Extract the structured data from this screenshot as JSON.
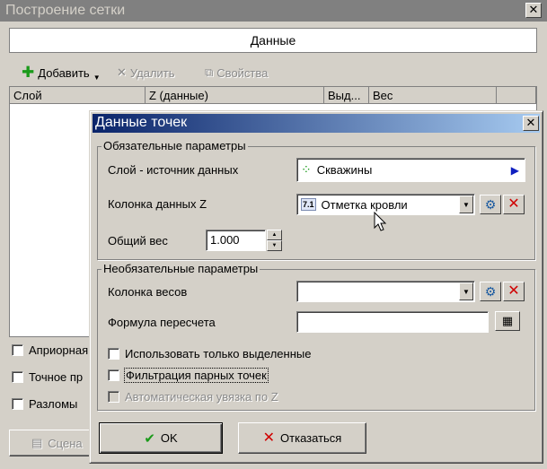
{
  "outer": {
    "title": "Построение сетки",
    "close": "✕",
    "header": "Данные",
    "toolbar": {
      "add": "Добавить",
      "delete": "Удалить",
      "properties": "Свойства"
    },
    "columns": [
      "Слой",
      "Z (данные)",
      "Выд...",
      "Вес"
    ],
    "options": [
      "Априорная",
      "Точное пр",
      "Разломы"
    ],
    "scenario_button": "Сцена"
  },
  "dialog": {
    "title": "Данные точек",
    "close": "✕",
    "required_group": "Обязательные параметры",
    "source_layer_label": "Слой - источник данных",
    "source_layer_value": "Скважины",
    "z_column_label": "Колонка данных Z",
    "z_column_value": "Отметка кровли",
    "z_column_badge": "7.1",
    "weight_label": "Общий вес",
    "weight_value": "1.000",
    "optional_group": "Необязательные параметры",
    "weights_column_label": "Колонка весов",
    "formula_label": "Формула пересчета",
    "use_selected": "Использовать только выделенные",
    "filter_pairs": "Фильтрация парных точек",
    "auto_link": "Автоматическая увязка по Z",
    "ok": "OK",
    "cancel": "Отказаться"
  },
  "colors": {
    "title_active": "#0a246a",
    "title_inactive": "#808080",
    "face": "#d4d0c8"
  }
}
